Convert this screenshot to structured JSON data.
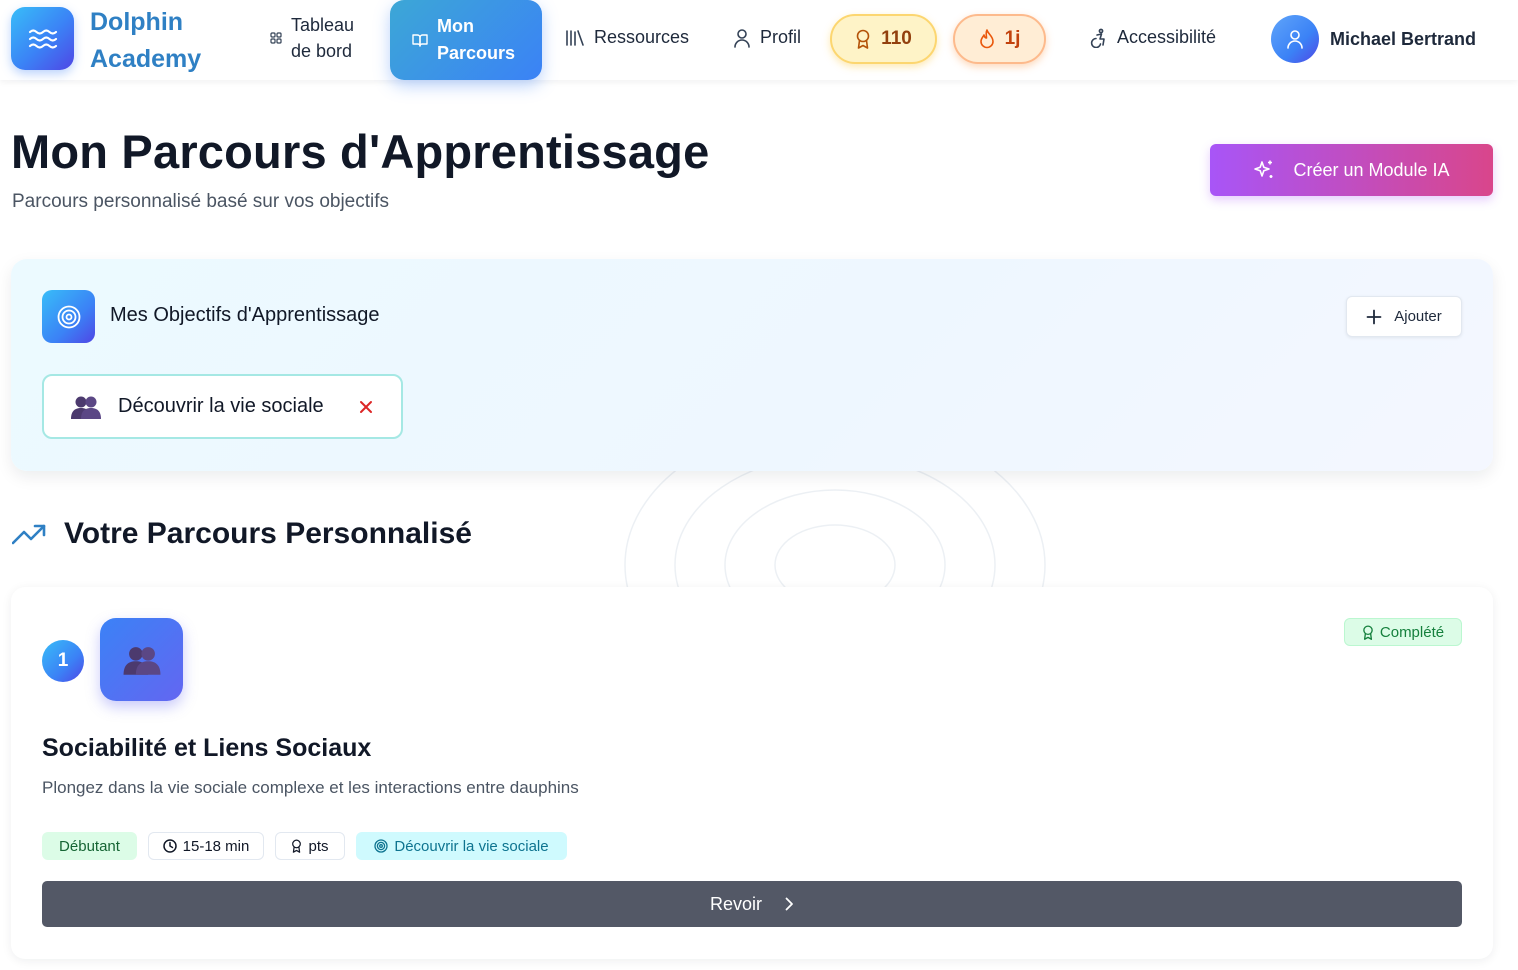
{
  "brand": {
    "name_line1": "Dolphin",
    "name_line2": "Academy"
  },
  "nav": {
    "dashboard_line1": "Tableau",
    "dashboard_line2": "de bord",
    "journey_line1": "Mon",
    "journey_line2": "Parcours",
    "resources": "Ressources",
    "profile": "Profil",
    "points": "110",
    "streak": "1j",
    "accessibility": "Accessibilité",
    "user_name": "Michael Bertrand"
  },
  "header": {
    "title": "Mon Parcours d'Apprentissage",
    "subtitle": "Parcours personnalisé basé sur vos objectifs",
    "ai_button": "Créer un Module IA"
  },
  "objectives": {
    "title": "Mes Objectifs d'Apprentissage",
    "add_button": "Ajouter",
    "items": [
      {
        "emoji": "👥",
        "label": "Découvrir la vie sociale"
      }
    ]
  },
  "journey": {
    "title": "Votre Parcours Personnalisé",
    "modules": [
      {
        "step": "1",
        "emoji": "👥",
        "status": "Complété",
        "title": "Sociabilité et Liens Sociaux",
        "description": "Plongez dans la vie sociale complexe et les interactions entre dauphins",
        "level": "Débutant",
        "duration": "15-18 min",
        "points": "pts",
        "objective": "Découvrir la vie sociale",
        "action": "Revoir"
      }
    ]
  },
  "colors": {
    "brand": "#2f80c4",
    "primary_gradient_start": "#38bdf8",
    "primary_gradient_end": "#4f46e5",
    "ai_gradient_start": "#a855f7",
    "ai_gradient_end": "#d9468b",
    "review_button": "#535866"
  }
}
